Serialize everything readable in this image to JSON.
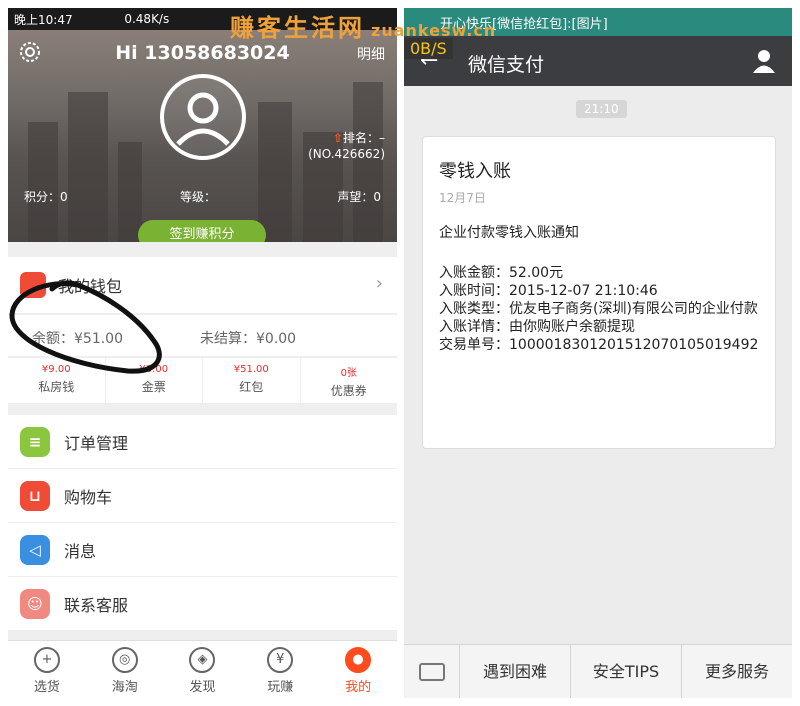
{
  "watermark": {
    "text": "赚客生活网",
    "site": "zuankesw.cn"
  },
  "left": {
    "status": {
      "time": "晚上10:47",
      "speed": "0.48K/s"
    },
    "header": {
      "greeting": "Hi 13058683024",
      "detail": "明细",
      "settings_icon": "gear-icon"
    },
    "rank": {
      "label": "排名：–",
      "no": "(NO.426662)"
    },
    "stats": {
      "points": "积分：0",
      "level": "等级：",
      "reputation": "声望：0"
    },
    "sign_button": "签到赚积分",
    "wallet": {
      "label": "我的钱包"
    },
    "balance": {
      "amount": "余额：¥51.00",
      "unsettled": "未结算：¥0.00"
    },
    "quad": [
      {
        "value": "¥9.00",
        "label": "私房钱"
      },
      {
        "value": "¥0.00",
        "label": "金票"
      },
      {
        "value": "¥51.00",
        "label": "红包"
      },
      {
        "value": "0张",
        "label": "优惠券"
      }
    ],
    "menu": [
      {
        "label": "订单管理",
        "icon": "order-icon",
        "color": "#8cc63f"
      },
      {
        "label": "购物车",
        "icon": "cart-icon",
        "color": "#f04b37"
      },
      {
        "label": "消息",
        "icon": "speaker-icon",
        "color": "#3a8fe0"
      },
      {
        "label": "联系客服",
        "icon": "service-icon",
        "color": "#f08a80"
      }
    ],
    "tabs": [
      {
        "label": "选货",
        "icon": "basket-icon"
      },
      {
        "label": "海淘",
        "icon": "globe-icon"
      },
      {
        "label": "发现",
        "icon": "compass-icon"
      },
      {
        "label": "玩赚",
        "icon": "yen-icon"
      },
      {
        "label": "我的",
        "icon": "person-icon",
        "active": true
      }
    ]
  },
  "right": {
    "status": {
      "notification": "开心快乐[微信抢红包]:[图片]"
    },
    "speed": "0B/S",
    "nav": {
      "title": "微信支付"
    },
    "time": "21:10",
    "card": {
      "title": "零钱入账",
      "date": "12月7日",
      "notice": "企业付款零钱入账通知",
      "amount": "入账金额：52.00元",
      "time": "入账时间：2015-12-07 21:10:46",
      "type": "入账类型：优友电子商务(深圳)有限公司的企业付款",
      "detail": "入账详情：由你购账户余额提现",
      "serial": "交易单号：1000018301201512070105019492"
    },
    "bottom": {
      "btn1": "遇到困难",
      "btn2": "安全TIPS",
      "btn3": "更多服务"
    }
  },
  "colors": {
    "accent": "#ff4b1e",
    "green": "#7ab234",
    "wechat_nav": "#3b3d40",
    "status_teal": "#2a8a7e"
  }
}
